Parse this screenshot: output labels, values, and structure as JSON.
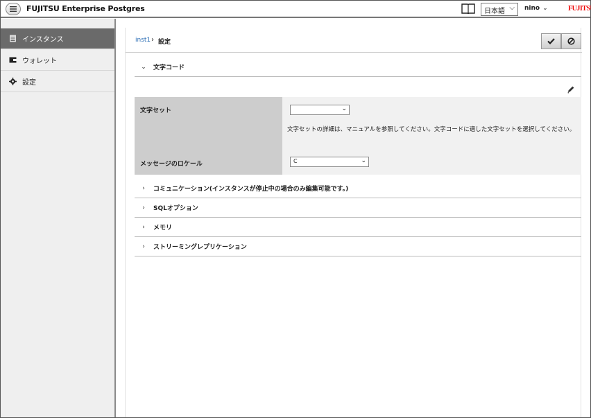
{
  "header": {
    "app_title": "FUJITSU Enterprise Postgres",
    "language": "日本語",
    "user": "nino",
    "brand": "FUJITSU"
  },
  "sidebar": {
    "items": [
      {
        "label": "インスタンス",
        "icon": "database-icon",
        "active": true
      },
      {
        "label": "ウォレット",
        "icon": "wallet-icon",
        "active": false
      },
      {
        "label": "設定",
        "icon": "gear-icon",
        "active": false
      }
    ]
  },
  "breadcrumb": {
    "link": "inst1",
    "current": "設定"
  },
  "sections": {
    "charcode": {
      "title": "文字コード",
      "expanded": true,
      "charset_label": "文字セット",
      "charset_value": "",
      "charset_hint": "文字セットの詳細は、マニュアルを参照してください。文字コードに適した文字セットを選択してください。",
      "locale_label": "メッセージのロケール",
      "locale_value": "C"
    },
    "collapsed": [
      {
        "title": "コミュニケーション(インスタンスが停止中の場合のみ編集可能です。)"
      },
      {
        "title": "SQLオプション"
      },
      {
        "title": "メモリ"
      },
      {
        "title": "ストリーミングレプリケーション"
      }
    ]
  },
  "colors": {
    "sidebar_active": "#6a6a6a",
    "link": "#2a6db5",
    "brand": "#e00000"
  }
}
